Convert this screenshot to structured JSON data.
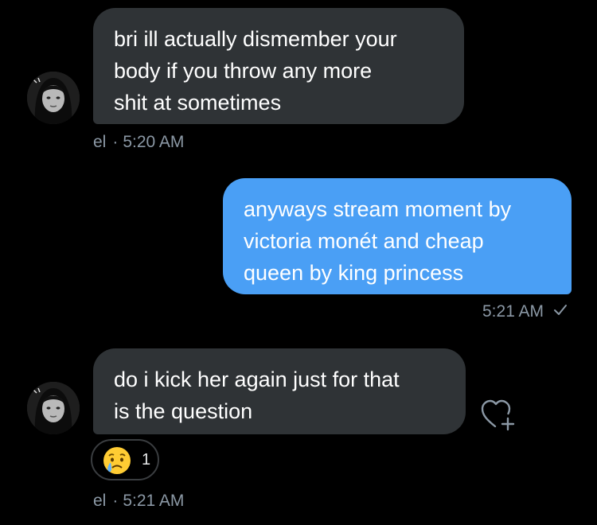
{
  "messages": [
    {
      "direction": "incoming",
      "text": "bri ill actually dismember your\nbody if you throw any more\nshit at sometimes",
      "sender": "el",
      "separator": "·",
      "time": "5:20 AM"
    },
    {
      "direction": "outgoing",
      "text": "anyways stream moment by\nvictoria monét and cheap\nqueen by king princess",
      "time": "5:21 AM",
      "status_icon": "checkmark-icon"
    },
    {
      "direction": "incoming",
      "text": "do i kick her again just for that\nis the question",
      "sender": "el",
      "separator": "·",
      "time": "5:21 AM",
      "reaction": {
        "emoji_icon": "crying-face-emoji",
        "count": "1"
      }
    }
  ],
  "actions": {
    "add_reaction_icon": "heart-plus-icon"
  },
  "colors": {
    "background": "#000000",
    "incoming_bubble": "#2f3336",
    "outgoing_bubble": "#4a9ff5",
    "meta_text": "#8b98a5"
  }
}
